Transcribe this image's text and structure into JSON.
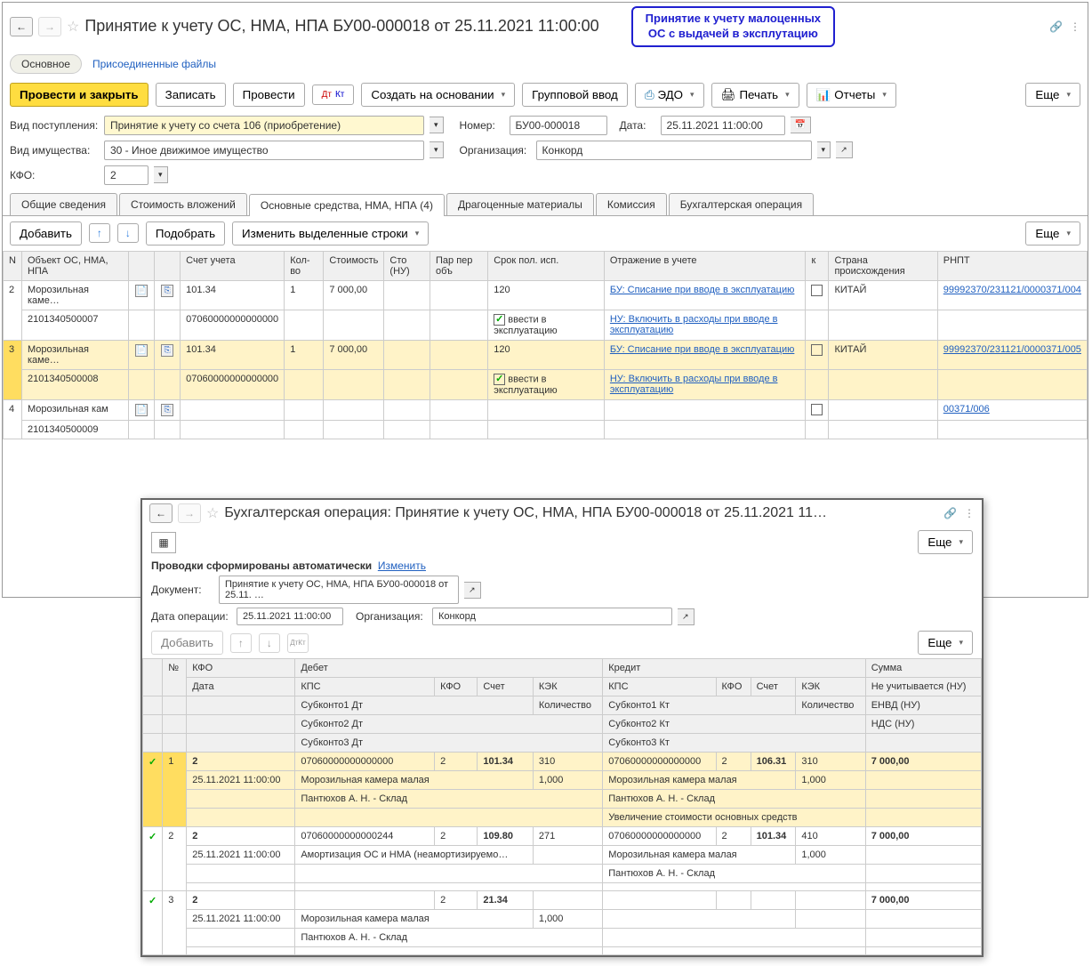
{
  "window": {
    "title": "Принятие к учету ОС, НМА, НПА БУ00-000018 от 25.11.2021 11:00:00",
    "callout_l1": "Принятие к учету малоценных",
    "callout_l2": "ОС с выдачей в эксплутацию"
  },
  "navTabs": {
    "main": "Основное",
    "files": "Присоединенные файлы"
  },
  "toolbar": {
    "postClose": "Провести и закрыть",
    "save": "Записать",
    "post": "Провести",
    "createBasedOn": "Создать на основании",
    "groupInput": "Групповой ввод",
    "edo": "ЭДО",
    "print": "Печать",
    "reports": "Отчеты",
    "more": "Еще"
  },
  "form": {
    "receiptType_lbl": "Вид поступления:",
    "receiptType": "Принятие к учету со счета 106 (приобретение)",
    "propertyType_lbl": "Вид имущества:",
    "propertyType": "30 - Иное движимое имущество",
    "kfo_lbl": "КФО:",
    "kfo": "2",
    "number_lbl": "Номер:",
    "number": "БУ00-000018",
    "date_lbl": "Дата:",
    "date": "25.11.2021 11:00:00",
    "org_lbl": "Организация:",
    "org": "Конкорд"
  },
  "tabs": {
    "general": "Общие сведения",
    "investCost": "Стоимость вложений",
    "assets": "Основные средства, НМА, НПА (4)",
    "precious": "Драгоценные материалы",
    "commission": "Комиссия",
    "accOp": "Бухгалтерская операция"
  },
  "subToolbar": {
    "add": "Добавить",
    "pick": "Подобрать",
    "editRows": "Изменить выделенные строки",
    "more": "Еще"
  },
  "gridHeaders": {
    "n": "N",
    "object": "Объект ОС, НМА, НПА",
    "account": "Счет учета",
    "qty": "Кол-во",
    "cost": "Стоимость",
    "costNU": "Сто (НУ)",
    "par": "Пар пер объ",
    "term": "Срок пол. исп.",
    "reflection": "Отражение в учете",
    "k": "к",
    "country": "Страна происхождения",
    "rnpt": "РНПТ"
  },
  "rows": [
    {
      "n": "2",
      "obj": "Морозильная каме…",
      "code": "2101340500007",
      "acct": "101.34",
      "acctCode": "07060000000000000",
      "qty": "1",
      "cost": "7 000,00",
      "term": "120",
      "introduce": "ввести в эксплуатацию",
      "refl_bu": "БУ: Списание при вводе в эксплуатацию",
      "refl_nu": "НУ: Включить в расходы при вводе в эксплуатацию",
      "country": "КИТАЙ",
      "rnpt": "99992370/231121/0000371/004",
      "hl": false
    },
    {
      "n": "3",
      "obj": "Морозильная каме…",
      "code": "2101340500008",
      "acct": "101.34",
      "acctCode": "07060000000000000",
      "qty": "1",
      "cost": "7 000,00",
      "term": "120",
      "introduce": "ввести в эксплуатацию",
      "refl_bu": "БУ: Списание при вводе в эксплуатацию",
      "refl_nu": "НУ: Включить в расходы при вводе в эксплуатацию",
      "country": "КИТАЙ",
      "rnpt": "99992370/231121/0000371/005",
      "hl": true
    },
    {
      "n": "4",
      "obj": "Морозильная кам",
      "code": "2101340500009",
      "acct": "",
      "acctCode": "",
      "qty": "",
      "cost": "",
      "term": "",
      "introduce": "",
      "refl_bu": "",
      "refl_nu": "",
      "country": "",
      "rnpt": "00371/006",
      "hl": false
    }
  ],
  "overlay": {
    "title": "Бухгалтерская операция: Принятие к учету ОС, НМА, НПА БУ00-000018 от 25.11.2021 11…",
    "autoPost": "Проводки сформированы автоматически",
    "change": "Изменить",
    "doc_lbl": "Документ:",
    "doc": "Принятие к учету ОС, НМА, НПА БУ00-000018 от 25.11. …",
    "opDate_lbl": "Дата операции:",
    "opDate": "25.11.2021 11:00:00",
    "org_lbl": "Организация:",
    "org": "Конкорд",
    "add": "Добавить",
    "more": "Еще",
    "hdr": {
      "n": "№",
      "kfo": "КФО",
      "date": "Дата",
      "debit": "Дебет",
      "credit": "Кредит",
      "sum": "Сумма",
      "kps": "КПС",
      "kfoS": "КФО",
      "acct": "Счет",
      "kek": "КЭК",
      "qty": "Количество",
      "noNU": "Не учитывается (НУ)",
      "envd": "ЕНВД (НУ)",
      "nds": "НДС (НУ)",
      "sub1d": "Субконто1 Дт",
      "sub2d": "Субконто2 Дт",
      "sub3d": "Субконто3 Дт",
      "sub1k": "Субконто1 Кт",
      "sub2k": "Субконто2 Кт",
      "sub3k": "Субконто3 Кт"
    },
    "rows": [
      {
        "n": "1",
        "kfo": "2",
        "date": "25.11.2021 11:00:00",
        "d_kps": "07060000000000000",
        "d_kfo": "2",
        "d_acct": "101.34",
        "d_kek": "310",
        "d_sub1": "Морозильная камера малая",
        "d_qty": "1,000",
        "d_sub2": "Пантюхов А. Н. - Склад",
        "k_kps": "07060000000000000",
        "k_kfo": "2",
        "k_acct": "106.31",
        "k_kek": "310",
        "k_sub1": "Морозильная камера малая",
        "k_qty": "1,000",
        "k_sub2": "Пантюхов А. Н. - Склад",
        "k_sub3": "Увеличение стоимости основных средств",
        "sum": "7 000,00",
        "hl": true
      },
      {
        "n": "2",
        "kfo": "2",
        "date": "25.11.2021 11:00:00",
        "d_kps": "07060000000000244",
        "d_kfo": "2",
        "d_acct": "109.80",
        "d_kek": "271",
        "d_sub1": "Амортизация ОС и НМА (неамортизируемо…",
        "d_qty": "",
        "d_sub2": "",
        "k_kps": "07060000000000000",
        "k_kfo": "2",
        "k_acct": "101.34",
        "k_kek": "410",
        "k_sub1": "Морозильная камера малая",
        "k_qty": "1,000",
        "k_sub2": "Пантюхов А. Н. - Склад",
        "k_sub3": "",
        "sum": "7 000,00",
        "hl": false
      },
      {
        "n": "3",
        "kfo": "2",
        "date": "25.11.2021 11:00:00",
        "d_kps": "",
        "d_kfo": "2",
        "d_acct": "21.34",
        "d_kek": "",
        "d_sub1": "Морозильная камера малая",
        "d_qty": "1,000",
        "d_sub2": "Пантюхов А. Н. - Склад",
        "k_kps": "",
        "k_kfo": "",
        "k_acct": "",
        "k_kek": "",
        "k_sub1": "",
        "k_qty": "",
        "k_sub2": "",
        "k_sub3": "",
        "sum": "7 000,00",
        "hl": false
      }
    ]
  }
}
